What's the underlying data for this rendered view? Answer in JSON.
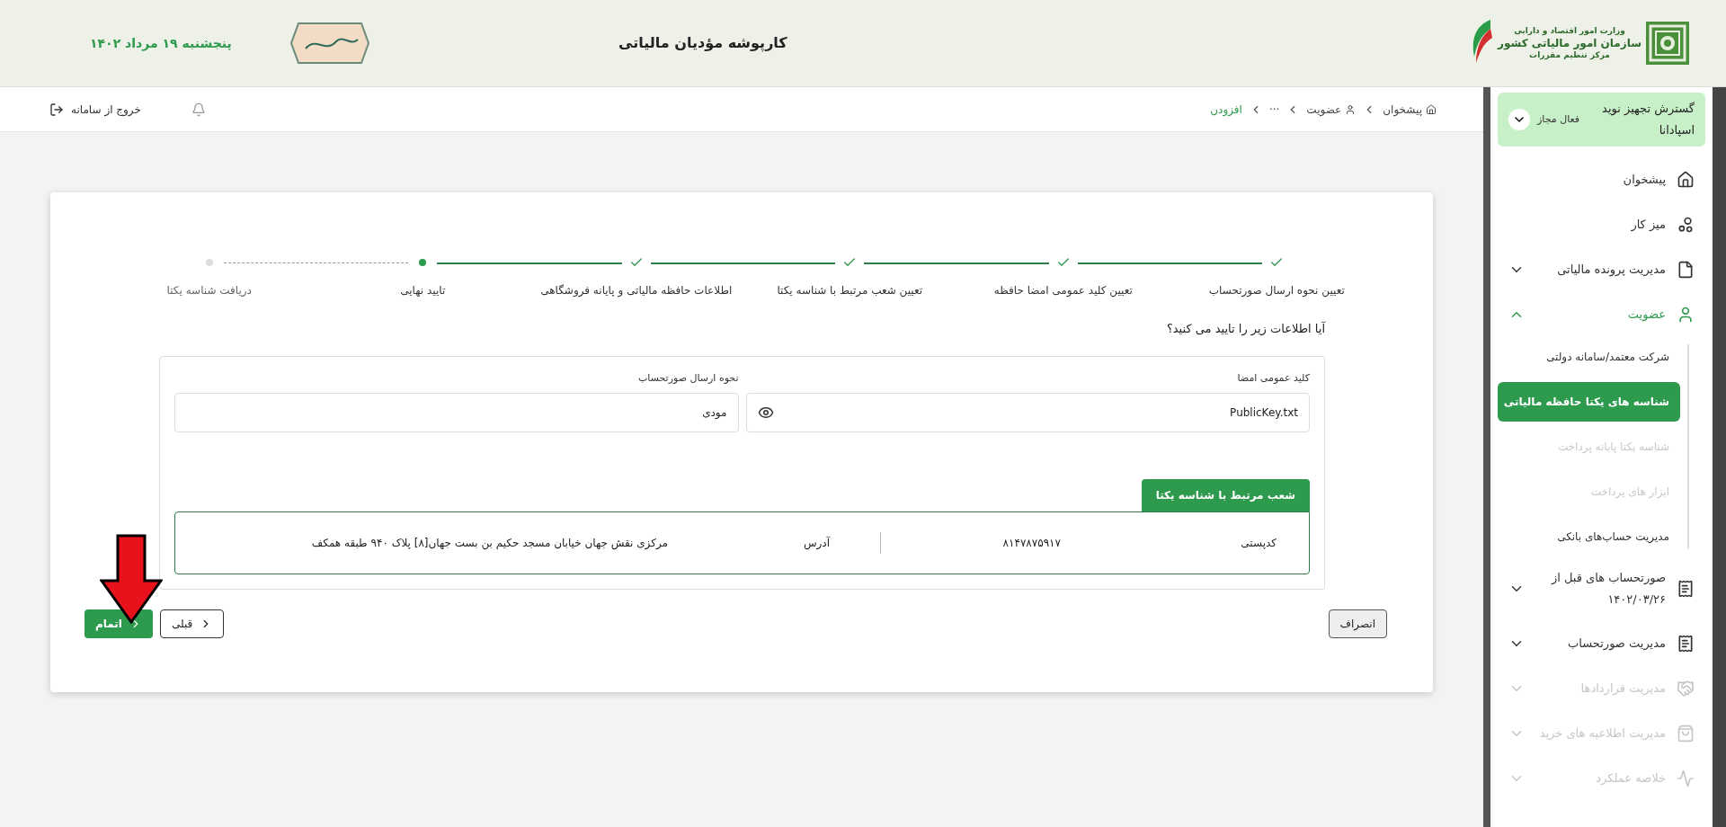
{
  "header": {
    "title": "کارپوشه مؤدیان مالیاتی",
    "date": "پنجشنبه ۱۹ مرداد ۱۴۰۲",
    "logo_lines": [
      "وزارت امور اقتصاد و دارایی",
      "سازمان امور مالیاتی کشور",
      "مرکز تنظیم مقررات"
    ]
  },
  "topbar": {
    "breadcrumb": [
      {
        "label": "پیشخوان",
        "current": false
      },
      {
        "label": "عضویت",
        "current": false
      },
      {
        "label": "···",
        "current": false
      },
      {
        "label": "افزودن",
        "current": true
      }
    ],
    "logout": "خروج از سامانه"
  },
  "sidebar": {
    "account": {
      "name": "گسترش تجهیز نوید اسپادانا",
      "status": "فعال مجاز"
    },
    "items": [
      {
        "label": "پیشخوان",
        "kind": "link",
        "disabled": false
      },
      {
        "label": "میز کار",
        "kind": "link",
        "disabled": false
      },
      {
        "label": "مدیریت پرونده مالیاتی",
        "kind": "group",
        "expanded": false,
        "disabled": false
      },
      {
        "label": "عضویت",
        "kind": "group",
        "expanded": true,
        "disabled": false,
        "children": [
          {
            "label": "شرکت معتمد/سامانه دولتی",
            "selected": false,
            "disabled": false
          },
          {
            "label": "شناسه های یکتا حافظه مالیاتی",
            "selected": true,
            "disabled": false
          },
          {
            "label": "شناسه یکتا پایانه پرداخت",
            "selected": false,
            "disabled": true
          },
          {
            "label": "ابزار های پرداخت",
            "selected": false,
            "disabled": true
          },
          {
            "label": "مدیریت حساب‌های بانکی",
            "selected": false,
            "disabled": false
          }
        ]
      },
      {
        "label": "صورتحساب های قبل از ۱۴۰۲/۰۳/۲۶",
        "kind": "group",
        "expanded": false,
        "disabled": false
      },
      {
        "label": "مدیریت صورتحساب",
        "kind": "group",
        "expanded": false,
        "disabled": false
      },
      {
        "label": "مدیریت قراردادها",
        "kind": "group",
        "expanded": false,
        "disabled": true
      },
      {
        "label": "مدیریت اطلاعیه های خرید",
        "kind": "group",
        "expanded": false,
        "disabled": true
      },
      {
        "label": "خلاصه عملکرد",
        "kind": "group",
        "expanded": false,
        "disabled": true
      }
    ]
  },
  "steps": [
    {
      "label": "تعیین نحوه ارسال صورتحساب",
      "kind": "done"
    },
    {
      "label": "تعیین کلید عمومی امضا حافظه",
      "kind": "done"
    },
    {
      "label": "تعیین شعب مرتبط با شناسه یکتا",
      "kind": "done"
    },
    {
      "label": "اطلاعات حافظه مالیاتی و پایانه فروشگاهی",
      "kind": "done"
    },
    {
      "label": "تایید نهایی",
      "kind": "current"
    },
    {
      "label": "دریافت شناسه یکتا",
      "kind": "pending"
    }
  ],
  "question": "آیا اطلاعات زیر را تایید می کنید؟",
  "fields": [
    {
      "label": "کلید عمومی امضا",
      "value": "PublicKey.txt",
      "kind": "file"
    },
    {
      "label": "نحوه ارسال صورتحساب",
      "value": "مودی",
      "kind": "text"
    }
  ],
  "branches": {
    "title": "شعب مرتبط با شناسه یکتا",
    "rows": [
      {
        "postal_label": "کدپستی",
        "postal": "۸۱۴۷۸۷۵۹۱۷",
        "address_label": "آدرس",
        "address": "مرکزی نقش جهان خیابان مسجد حکیم بن بست جهان[۸] پلاک ۹۴۰ طبقه همکف"
      }
    ]
  },
  "buttons": {
    "cancel": "انصراف",
    "previous": "قبلی",
    "finish": "اتمام"
  }
}
